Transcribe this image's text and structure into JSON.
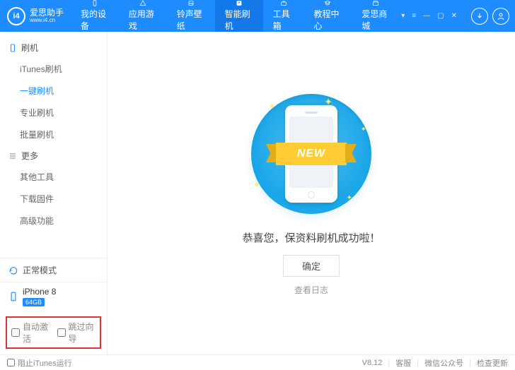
{
  "brand": {
    "logo_text_cn": "爱思助手",
    "logo_text_en": "www.i4.cn",
    "logo_badge": "i4"
  },
  "header": {
    "tabs": [
      {
        "key": "device",
        "label": "我的设备"
      },
      {
        "key": "apps",
        "label": "应用游戏"
      },
      {
        "key": "ringtone",
        "label": "铃声壁纸"
      },
      {
        "key": "flash",
        "label": "智能刷机"
      },
      {
        "key": "toolbox",
        "label": "工具箱"
      },
      {
        "key": "tutorial",
        "label": "教程中心"
      },
      {
        "key": "mall",
        "label": "爱思商城"
      }
    ],
    "active_tab": 3
  },
  "sidebar": {
    "section1": {
      "title": "刷机",
      "items": [
        "iTunes刷机",
        "一键刷机",
        "专业刷机",
        "批量刷机"
      ],
      "active_index": 1
    },
    "section2": {
      "title": "更多",
      "items": [
        "其他工具",
        "下载固件",
        "高级功能"
      ]
    },
    "mode_label": "正常模式",
    "device": {
      "name": "iPhone 8",
      "storage": "64GB"
    },
    "checks": {
      "auto_activate": "自动激活",
      "skip_wizard": "跳过向导"
    }
  },
  "content": {
    "ribbon_text": "NEW",
    "message": "恭喜您，保资料刷机成功啦！",
    "ok_label": "确定",
    "log_link_label": "查看日志"
  },
  "statusbar": {
    "block_itunes": "阻止iTunes运行",
    "version": "V8.12",
    "links": [
      "客服",
      "微信公众号",
      "检查更新"
    ]
  }
}
